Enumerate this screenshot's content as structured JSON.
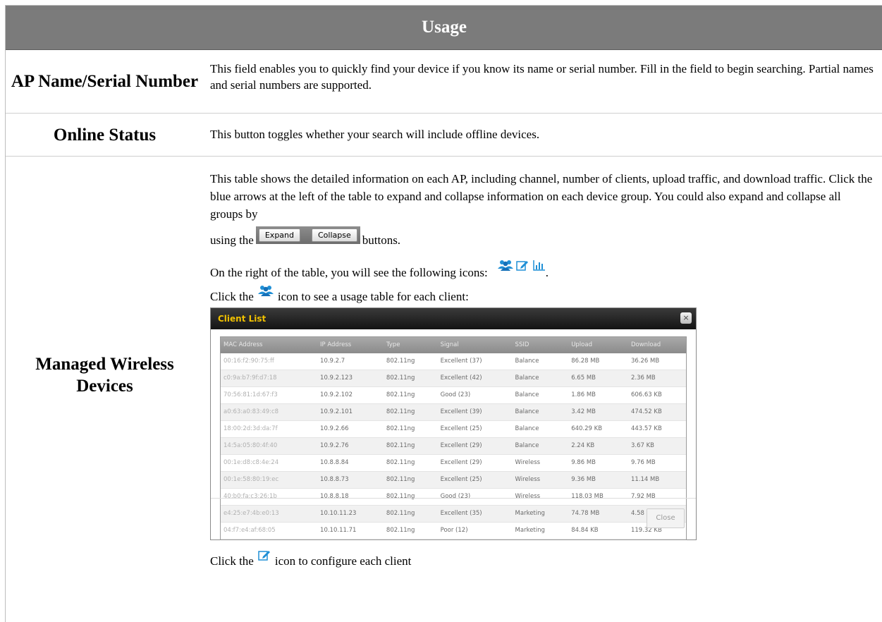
{
  "title": "Usage",
  "rows": {
    "ap_name": {
      "label": "AP Name/Serial Number",
      "text": "This field enables you to quickly find your device if you know its name or serial number. Fill in the field to begin searching. Partial names and serial numbers are supported."
    },
    "online_status": {
      "label": "Online Status",
      "text": "This button toggles whether your search will include offline devices."
    },
    "managed": {
      "label": "Managed Wireless Devices",
      "intro": "This table shows the detailed information on each AP, including channel, number of clients, upload traffic, and download traffic. Click the blue arrows at the left of the table to expand and collapse information on each device group. You could also expand and collapse all groups by",
      "using_the": "using the",
      "buttons_suffix": "buttons.",
      "expand_label": "Expand",
      "collapse_label": "Collapse",
      "icons_text": "On the right of the table, you will see the following icons:",
      "icons_period": ".",
      "click_prefix": "Click the",
      "click_clients_suffix": "icon to see a usage table for each client:",
      "click_config_suffix": "icon to configure each client"
    }
  },
  "dialog": {
    "title": "Client List",
    "close_icon": "×",
    "close_button": "Close",
    "columns": [
      "MAC Address",
      "IP Address",
      "Type",
      "Signal",
      "SSID",
      "Upload",
      "Download"
    ],
    "rows": [
      [
        "00:16:f2:90:75:ff",
        "10.9.2.7",
        "802.11ng",
        "Excellent (37)",
        "Balance",
        "86.28 MB",
        "36.26 MB"
      ],
      [
        "c0:9a:b7:9f:d7:18",
        "10.9.2.123",
        "802.11ng",
        "Excellent (42)",
        "Balance",
        "6.65 MB",
        "2.36 MB"
      ],
      [
        "70:56:81:1d:67:f3",
        "10.9.2.102",
        "802.11ng",
        "Good (23)",
        "Balance",
        "1.86 MB",
        "606.63 KB"
      ],
      [
        "a0:63:a0:83:49:c8",
        "10.9.2.101",
        "802.11ng",
        "Excellent (39)",
        "Balance",
        "3.42 MB",
        "474.52 KB"
      ],
      [
        "18:00:2d:3d:da:7f",
        "10.9.2.66",
        "802.11ng",
        "Excellent (25)",
        "Balance",
        "640.29 KB",
        "443.57 KB"
      ],
      [
        "14:5a:05:80:4f:40",
        "10.9.2.76",
        "802.11ng",
        "Excellent (29)",
        "Balance",
        "2.24 KB",
        "3.67 KB"
      ],
      [
        "00:1e:d8:c8:4e:24",
        "10.8.8.84",
        "802.11ng",
        "Excellent (29)",
        "Wireless",
        "9.86 MB",
        "9.76 MB"
      ],
      [
        "00:1e:58:80:19:ec",
        "10.8.8.73",
        "802.11ng",
        "Excellent (25)",
        "Wireless",
        "9.36 MB",
        "11.14 MB"
      ],
      [
        "40:b0:fa:c3:26:1b",
        "10.8.8.18",
        "802.11ng",
        "Good (23)",
        "Wireless",
        "118.03 MB",
        "7.92 MB"
      ],
      [
        "e4:25:e7:4b:e0:13",
        "10.10.11.23",
        "802.11ng",
        "Excellent (35)",
        "Marketing",
        "74.78 MB",
        "4.58 MB"
      ],
      [
        "04:f7:e4:af:68:05",
        "10.10.11.71",
        "802.11ng",
        "Poor (12)",
        "Marketing",
        "84.84 KB",
        "119.32 KB"
      ]
    ]
  },
  "icons": {
    "clients": "users-icon",
    "configure": "edit-icon",
    "usage": "bar-chart-icon",
    "accent": "#1f8fd6"
  }
}
